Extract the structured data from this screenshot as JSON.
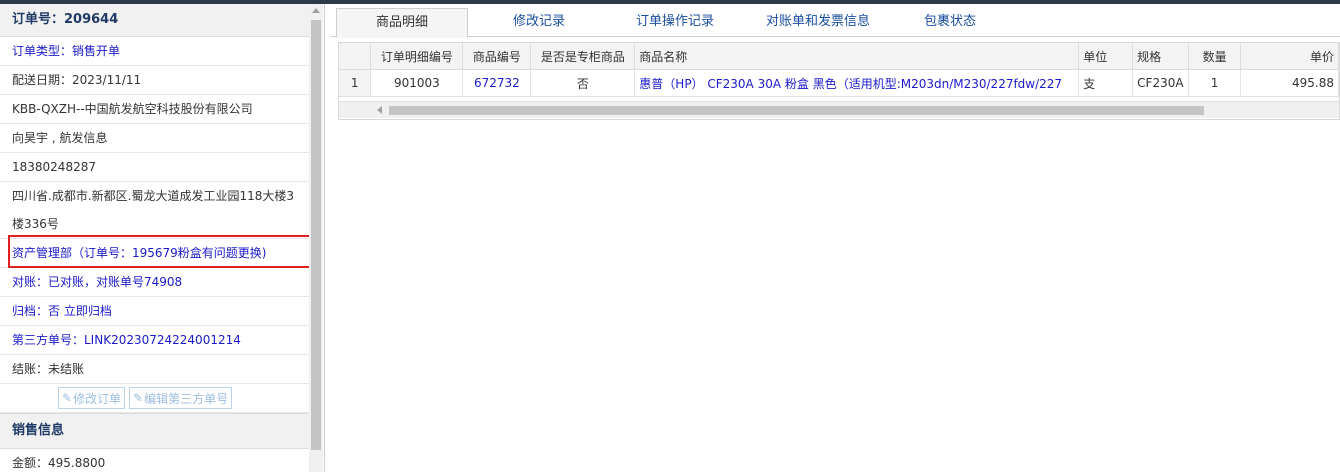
{
  "order": {
    "title": "订单号：209644",
    "order_type": "订单类型：销售开单",
    "delivery_date": "配送日期：2023/11/11",
    "customer": "KBB-QXZH--中国航发航空科技股份有限公司",
    "contact": "向昊宇 , 航发信息",
    "phone": "18380248287",
    "address": "四川省.成都市.新都区.蜀龙大道成发工业园118大楼3楼336号",
    "department": "资产管理部（订单号：195679粉盒有问题更换)",
    "reconcile_label": "对账：",
    "reconcile_value": "已对账，对账单号74908",
    "archive_label": "归档：",
    "archive_value": "否 立即归档",
    "third_party": "第三方单号：LINK20230724224001214",
    "settle_label": "结账：",
    "settle_value": "未结账",
    "edit_order_btn": "修改订单",
    "edit_third_btn": "编辑第三方单号"
  },
  "sales": {
    "title": "销售信息",
    "amount": "金额：495.8800"
  },
  "tabs": [
    "商品明细",
    "修改记录",
    "订单操作记录",
    "对账单和发票信息",
    "包裹状态"
  ],
  "table": {
    "headers": [
      "",
      "订单明细编号",
      "商品编号",
      "是否是专柜商品",
      "商品名称",
      "单位",
      "规格",
      "数量",
      "单价"
    ],
    "rows": [
      [
        "1",
        "901003",
        "672732",
        "否",
        "惠普（HP） CF230A 30A 粉盒 黑色（适用机型:M203dn/M230/227fdw/227",
        "支",
        "CF230A",
        "1",
        "495.88"
      ]
    ]
  },
  "colors": {
    "link": "#1a1acc",
    "highlight_border": "#e02020",
    "header_bg": "#f1f1f1"
  }
}
